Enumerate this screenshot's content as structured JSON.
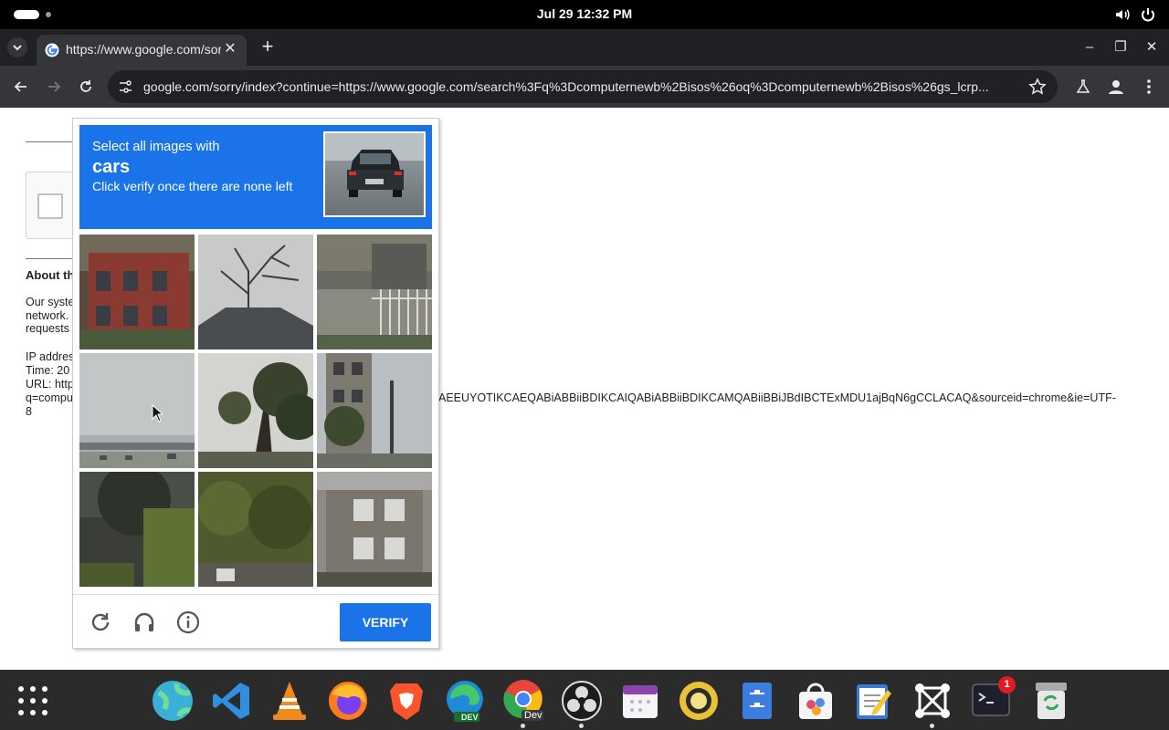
{
  "system_bar": {
    "clock": "Jul 29  12:32 PM"
  },
  "browser": {
    "tab": {
      "title": "https://www.google.com/sorry/index?continue",
      "close": "✕"
    },
    "new_tab": "+",
    "window_buttons": {
      "minimize": "–",
      "maximize": "❐",
      "close": "✕"
    },
    "address_bar": {
      "url": "google.com/sorry/index?continue=https://www.google.com/search%3Fq%3Dcomputernewb%2Bisos%26oq%3Dcomputernewb%2Bisos%26gs_lcrp..."
    }
  },
  "page": {
    "about_heading": "About th",
    "system_text": [
      "Our syste",
      "network.",
      "requests"
    ],
    "ip_text": [
      "IP addres",
      "Time: 20",
      "URL: http",
      "q=compu"
    ],
    "url_tail": "AEEUYOTIKCAEQABiABBiiBDIKCAIQABiABBiiBDIKCAMQABiiBBiJBdIBCTExMDU1ajBqN6gCCLACAQ&sourceid=chrome&ie=UTF-",
    "url_tail_end": "8"
  },
  "captcha": {
    "line1": "Select all images with",
    "object": "cars",
    "line3": "Click verify once there are none left",
    "verify_label": "VERIFY",
    "tiles": [
      "tile-1",
      "tile-2",
      "tile-3",
      "tile-4",
      "tile-5",
      "tile-6",
      "tile-7",
      "tile-8",
      "tile-9"
    ]
  },
  "dock": {
    "apps": [
      "files-globe",
      "vscode",
      "vlc",
      "firefox",
      "brave",
      "edge-dev",
      "chrome-dev",
      "obs",
      "calendar",
      "speaker",
      "file-cabinet",
      "software-store",
      "text-editor",
      "workspace",
      "terminal",
      "trash"
    ],
    "terminal_badge": "1",
    "chrome_dev_label": "Dev",
    "edge_dev_label": "DEV"
  },
  "colors": {
    "captcha_blue": "#1a73e8",
    "chrome_dark": "#202124",
    "toolbar": "#35363a"
  }
}
